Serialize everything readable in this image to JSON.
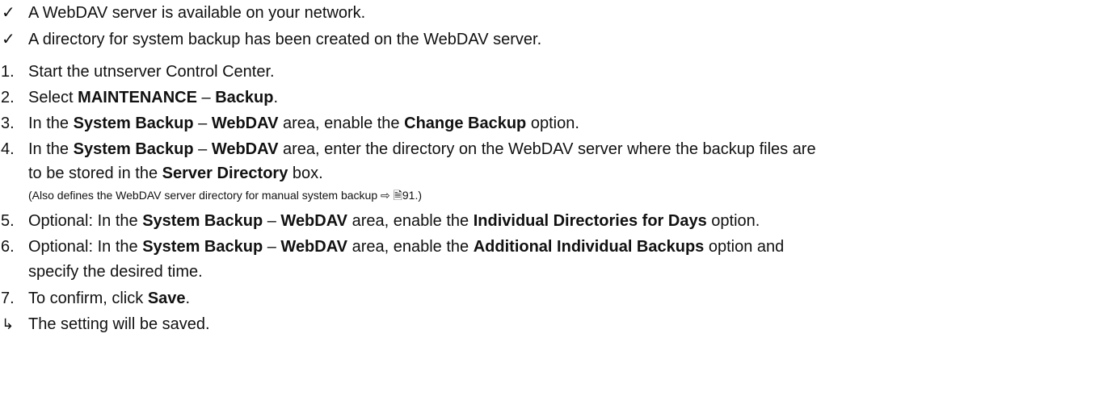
{
  "prerequisites": [
    {
      "mark": "✓",
      "text": "A WebDAV server is available on your network."
    },
    {
      "mark": "✓",
      "text": "A directory for system backup has been created on the WebDAV server."
    }
  ],
  "steps": {
    "s1": {
      "num": "1.",
      "t1": "Start the utnserver Control Center."
    },
    "s2": {
      "num": "2.",
      "t1": "Select ",
      "b1": "MAINTENANCE",
      "t2": " – ",
      "b2": "Backup",
      "t3": "."
    },
    "s3": {
      "num": "3.",
      "t1": "In the ",
      "b1": "System Backup",
      "t2": " – ",
      "b2": "WebDAV",
      "t3": " area, enable the ",
      "b3": "Change Backup",
      "t4": " option."
    },
    "s4": {
      "num": "4.",
      "t1": "In the ",
      "b1": "System Backup",
      "t2": " – ",
      "b2": "WebDAV",
      "t3": " area, enter the directory on the WebDAV server where the backup files are"
    },
    "s4b": {
      "t1": "to be stored in the ",
      "b1": "Server Directory",
      "t2": " box."
    },
    "s4note": {
      "text": "(Also defines the WebDAV server directory for manual system backup ⇨ 🗎91.)"
    },
    "s5": {
      "num": "5.",
      "t1": "Optional: In the ",
      "b1": "System Backup",
      "t2": " – ",
      "b2": "WebDAV",
      "t3": " area, enable the ",
      "b3": "Individual Directories for Days",
      "t4": " option."
    },
    "s6": {
      "num": "6.",
      "t1": "Optional: In the ",
      "b1": "System Backup",
      "t2": " – ",
      "b2": "WebDAV",
      "t3": " area, enable the ",
      "b3": "Additional Individual Backups",
      "t4": " option and"
    },
    "s6b": {
      "t1": "specify the desired time."
    },
    "s7": {
      "num": "7.",
      "t1": "To confirm, click ",
      "b1": "Save",
      "t2": "."
    }
  },
  "result": {
    "mark": "↳",
    "text": "The setting will be saved."
  }
}
